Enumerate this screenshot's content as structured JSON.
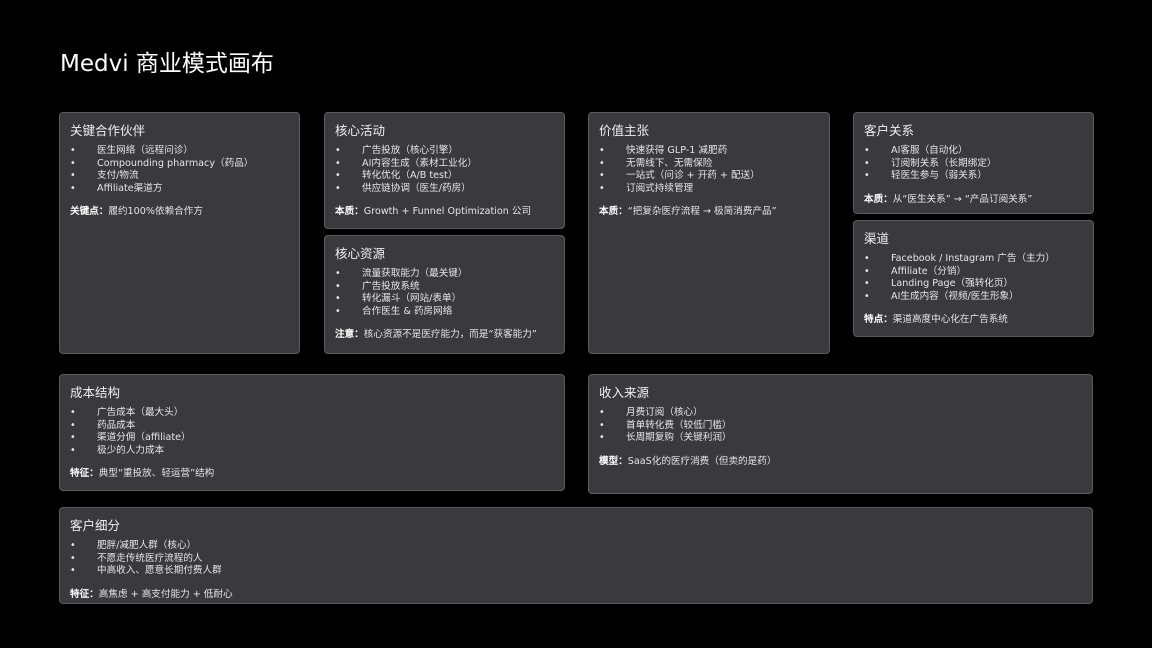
{
  "title": "Medvi 商业模式画布",
  "bullet": "•",
  "cards": {
    "partners": {
      "title": "关键合作伙伴",
      "items": [
        "医生网络（远程问诊）",
        "Compounding pharmacy（药品）",
        "支付/物流",
        "Affiliate渠道方"
      ],
      "note_label": "关键点：",
      "note_text": "履约100%依赖合作方"
    },
    "activities": {
      "title": "核心活动",
      "items": [
        "广告投放（核心引擎）",
        "AI内容生成（素材工业化）",
        "转化优化（A/B test）",
        "供应链协调（医生/药房）"
      ],
      "note_label": "本质：",
      "note_text": "Growth + Funnel Optimization 公司"
    },
    "resources": {
      "title": "核心资源",
      "items": [
        "流量获取能力（最关键）",
        "广告投放系统",
        "转化漏斗（网站/表单）",
        "合作医生 & 药房网络"
      ],
      "note_label": "注意：",
      "note_text": "核心资源不是医疗能力，而是“获客能力”"
    },
    "value": {
      "title": "价值主张",
      "items": [
        "快速获得 GLP-1 减肥药",
        "无需线下、无需保险",
        "一站式（问诊 + 开药 + 配送）",
        "订阅式持续管理"
      ],
      "note_label": "本质：",
      "note_text": "“把复杂医疗流程 → 极简消费产品”"
    },
    "relations": {
      "title": "客户关系",
      "items": [
        "AI客服（自动化）",
        "订阅制关系（长期绑定）",
        "轻医生参与（弱关系）"
      ],
      "note_label": "本质：",
      "note_text": "从“医生关系” → “产品订阅关系”"
    },
    "channels": {
      "title": "渠道",
      "items": [
        "Facebook / Instagram 广告（主力）",
        "Affiliate（分销）",
        "Landing Page（强转化页）",
        "AI生成内容（视频/医生形象）"
      ],
      "note_label": "特点：",
      "note_text": "渠道高度中心化在广告系统"
    },
    "costs": {
      "title": "成本结构",
      "items": [
        "广告成本（最大头）",
        "药品成本",
        "渠道分佣（affiliate）",
        "极少的人力成本"
      ],
      "note_label": "特征：",
      "note_text": "典型“重投放、轻运营”结构"
    },
    "revenue": {
      "title": "收入来源",
      "items": [
        "月费订阅（核心）",
        "首单转化费（较低门槛）",
        "长周期复购（关键利润）"
      ],
      "note_label": "模型：",
      "note_text": "SaaS化的医疗消费（但卖的是药）"
    },
    "segments": {
      "title": "客户细分",
      "items": [
        "肥胖/减肥人群（核心）",
        "不愿走传统医疗流程的人",
        "中高收入、愿意长期付费人群"
      ],
      "note_label": "特征：",
      "note_text": "高焦虑 + 高支付能力 + 低耐心"
    }
  }
}
